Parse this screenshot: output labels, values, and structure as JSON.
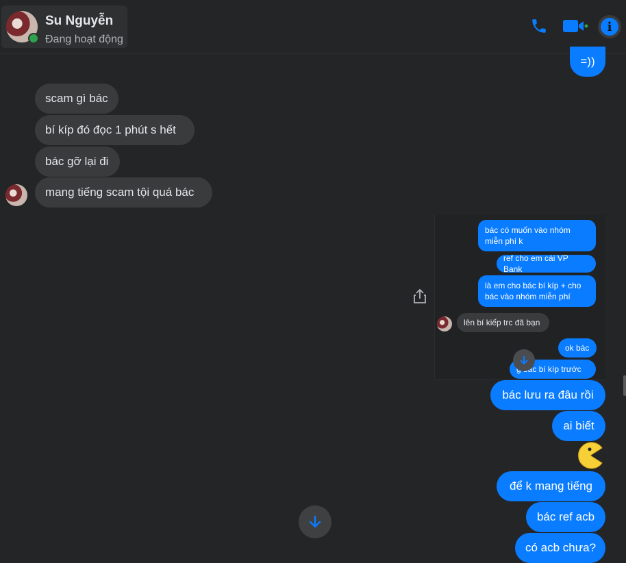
{
  "header": {
    "contact_name": "Su Nguyễn",
    "status": "Đang hoạt động",
    "icons": [
      "phone-icon",
      "video-icon",
      "info-icon"
    ],
    "accent": "#0a7cff"
  },
  "messages": {
    "sent_top": "=))",
    "received": [
      "scam gì bác",
      "bí kíp đó đọc 1 phút s hết",
      "bác gỡ lại đi",
      "mang tiếng scam tội quá bác"
    ],
    "sent": [
      "bác lưu ra đâu rồi",
      "ai biết",
      "để k mang tiếng",
      "bác ref acb",
      "có acb chưa?"
    ]
  },
  "screenshot": {
    "messages": [
      {
        "dir": "out",
        "text": "bác có muốn vào nhóm miễn phí k"
      },
      {
        "dir": "out",
        "text": "ref cho em cái VP Bank"
      },
      {
        "dir": "out",
        "text": "là em cho bác bí kíp + cho bác vào nhóm miễn phí"
      },
      {
        "dir": "in",
        "text": "lên bí kiếp trc đã bạn"
      },
      {
        "dir": "out",
        "text": "ok bác"
      },
      {
        "dir": "out",
        "text": "g   bác bí kíp trước"
      }
    ]
  },
  "colors": {
    "background": "#242526",
    "bubble_in": "#3a3b3c",
    "bubble_out": "#0a7cff",
    "online": "#31a24c"
  }
}
